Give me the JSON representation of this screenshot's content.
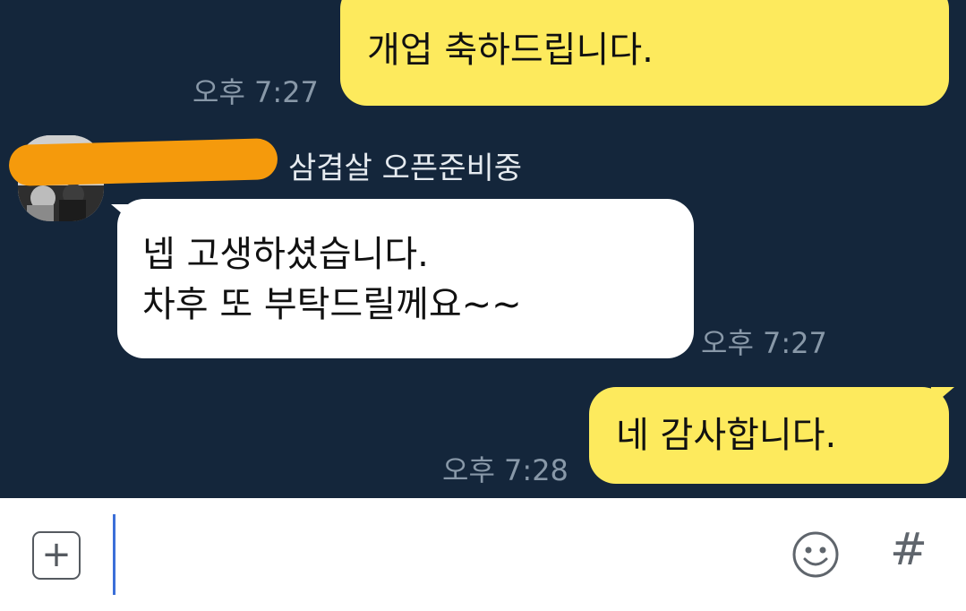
{
  "chat": {
    "messages": [
      {
        "sender": "me",
        "text": "개업 축하드립니다.",
        "time": "오후 7:27"
      },
      {
        "sender": "other",
        "sender_name": "삼겹살 오픈준비중",
        "lines": [
          "넵 고생하셨습니다.",
          "차후 또 부탁드릴께요~~"
        ],
        "time": "오후 7:27"
      },
      {
        "sender": "me",
        "text": "네 감사합니다.",
        "time": "오후 7:28"
      }
    ]
  },
  "input": {
    "plus_icon": "plus-box-icon",
    "emoji_icon": "smiley-icon",
    "hash_icon": "hash-icon",
    "plus_symbol": "+",
    "hash_symbol": "#"
  },
  "colors": {
    "chat_background": "#14263b",
    "my_bubble": "#fdea5d",
    "their_bubble": "#ffffff",
    "timestamp": "#8898a8",
    "redaction": "#f59a0c",
    "cursor": "#3b6fd8"
  }
}
